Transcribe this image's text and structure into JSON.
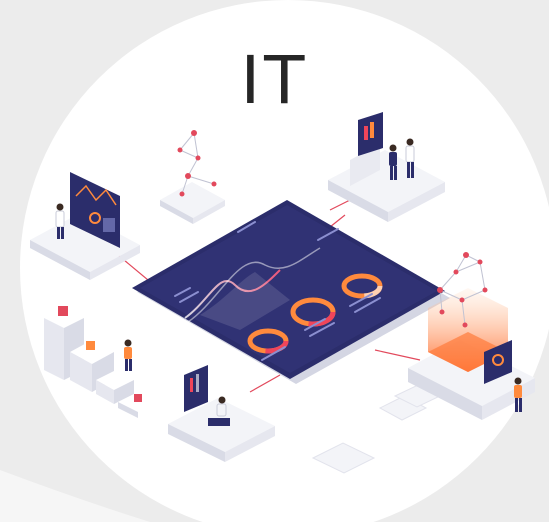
{
  "title": "IT",
  "colors": {
    "background": "#ececec",
    "circle": "#ffffff",
    "board": "#2b2d6b",
    "accent_orange": "#ff8a3d",
    "accent_red": "#f0455a",
    "platform": "#f3f4f8",
    "platform_side": "#d9dbe6",
    "connector": "#e2495c"
  },
  "icons": [
    "analytics-board-icon",
    "people-icon",
    "network-nodes-icon",
    "server-icon"
  ]
}
